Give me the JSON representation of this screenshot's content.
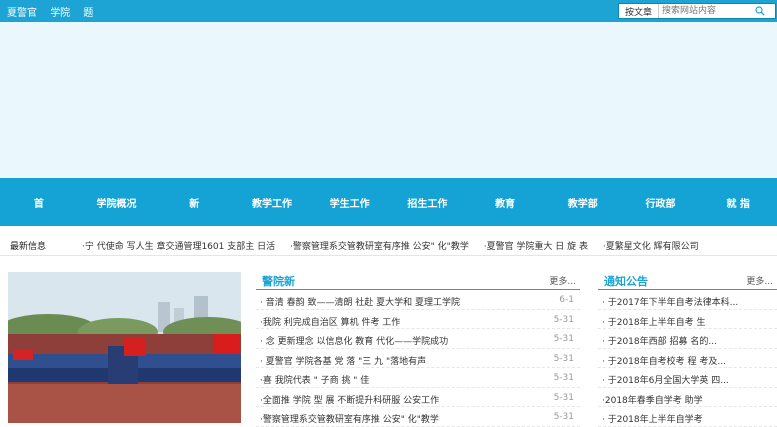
{
  "topbar": {
    "links": [
      "夏警官",
      "学院",
      "题"
    ],
    "search_type": "按文章",
    "search_placeholder": "搜索网站内容"
  },
  "nav": {
    "items": [
      "首",
      "学院概况",
      "新",
      "教学工作",
      "学生工作",
      "招生工作",
      "教育",
      "教学部",
      "行政部",
      "就 指"
    ]
  },
  "newsbar": {
    "label": "最新信息",
    "items": [
      "·宁  代使命  写人生  章交通管理1601 支部主  日活",
      "·警察管理系交管教研室有序推  公安\" 化\"教学",
      "·夏警官  学院重大 日  旋   表",
      "·夏繁星文化  辉有限公司"
    ]
  },
  "colors": {
    "primary": "#1da3d4",
    "nav": "#15a3d5"
  },
  "news": {
    "title": "警院新",
    "more": "更多...",
    "items": [
      {
        "title": "· 音清  春韵  致——清朗  社赴  夏大学和  夏理工学院",
        "date": "6-1"
      },
      {
        "title": "·我院  利完成自治区  算机  件考  工作",
        "date": "5-31"
      },
      {
        "title": "·    念  更新理念  以信息化  教育  代化——学院成功",
        "date": "5-31"
      },
      {
        "title": "· 夏警官   学院各基  党    落 \"三  九 \"落地有声",
        "date": "5-31"
      },
      {
        "title": "·喜   我院代表 \" 子商  挑    \"  佳",
        "date": "5-31"
      },
      {
        "title": "·全面推  学院  型  展  不断提升科研服  公安工作",
        "date": "5-31"
      },
      {
        "title": "·警察管理系交管教研室有序推  公安\" 化\"教学",
        "date": "5-31"
      }
    ]
  },
  "notice": {
    "title": "通知公告",
    "more": "更多...",
    "items": [
      {
        "title": "· 于2017年下半年自考法律本科...",
        "date": ""
      },
      {
        "title": "· 于2018年上半年自考    生",
        "date": ""
      },
      {
        "title": "· 于2018年西部  招募  名的...",
        "date": ""
      },
      {
        "title": "· 于2018年自考校考  程  考及...",
        "date": ""
      },
      {
        "title": "· 于2018年6月全国大学英  四...",
        "date": ""
      },
      {
        "title": "·2018年春季自学考  助学",
        "date": ""
      },
      {
        "title": "· 于2018年上半年自学考",
        "date": ""
      }
    ]
  }
}
